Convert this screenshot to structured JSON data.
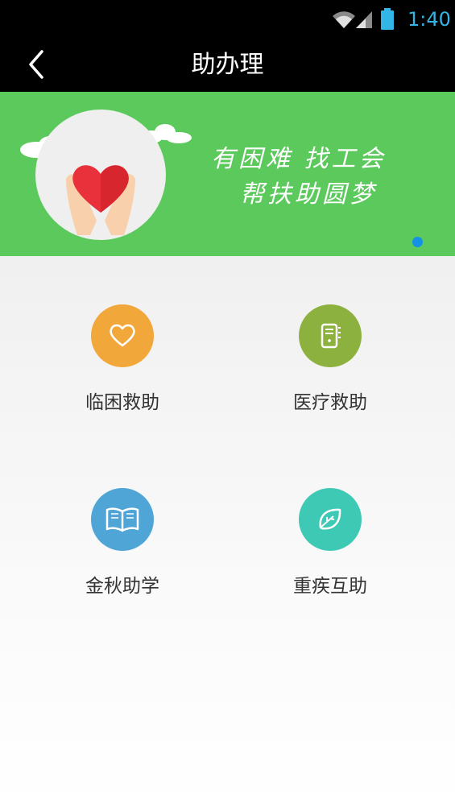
{
  "status_bar": {
    "time": "1:40",
    "icons": [
      "wifi-icon",
      "signal-icon",
      "battery-icon"
    ]
  },
  "header": {
    "title": "助办理",
    "back_icon": "back-arrow-icon"
  },
  "banner": {
    "slogan_line1": "有困难 找工会",
    "slogan_line2": "帮扶助圆梦",
    "image": "heart-in-hands-illustration",
    "indicator_color": "#1592e6",
    "background_color": "#5bc95c"
  },
  "services": [
    {
      "label": "临困救助",
      "icon": "heart-icon",
      "color": "#f2a73b"
    },
    {
      "label": "医疗救助",
      "icon": "medical-record-icon",
      "color": "#8db13e"
    },
    {
      "label": "金秋助学",
      "icon": "book-icon",
      "color": "#4fa6d6"
    },
    {
      "label": "重疾互助",
      "icon": "leaf-icon",
      "color": "#3ec9b4"
    }
  ]
}
